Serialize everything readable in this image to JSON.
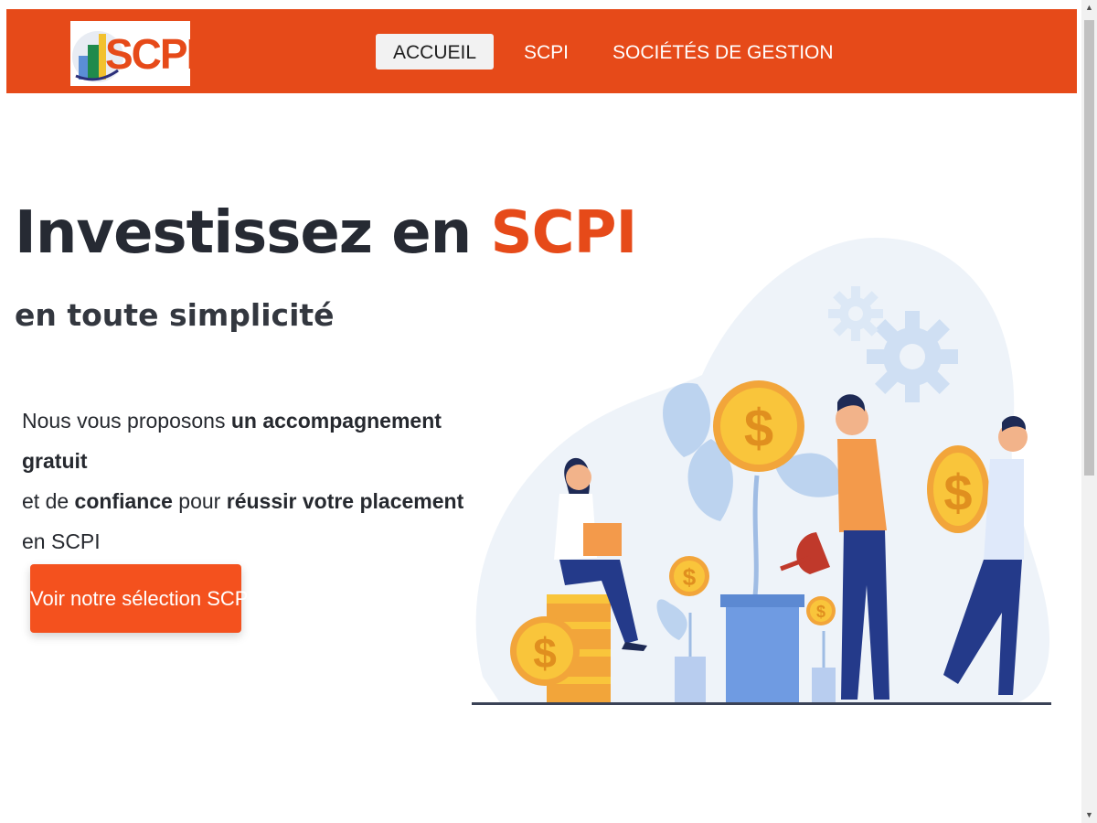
{
  "header": {
    "logo_text": "SCPI",
    "nav": [
      {
        "label": "ACCUEIL",
        "active": true
      },
      {
        "label": "SCPI",
        "active": false
      },
      {
        "label": "SOCIÉTÉS DE GESTION",
        "active": false
      }
    ]
  },
  "hero": {
    "title_main": "Investissez en ",
    "title_accent": "SCPI",
    "subtitle": "en toute simplicité",
    "desc": {
      "p1": "Nous vous proposons ",
      "b1": "un accompagnement gratuit",
      "p2": " et de ",
      "b2": "confiance",
      "p3": " pour ",
      "b3": "réussir votre placement",
      "p4": " en SCPI"
    },
    "cta_label": "Voir notre sélection SCPI"
  },
  "illustration": {
    "coin_symbol": "$"
  },
  "colors": {
    "brand": "#e64a19",
    "cta": "#f4511e",
    "text_dark": "#262a33"
  },
  "icons": [
    "gear-icon",
    "dollar-coin-icon",
    "watering-can-icon",
    "laptop-icon",
    "scroll-up-icon",
    "scroll-down-icon"
  ]
}
